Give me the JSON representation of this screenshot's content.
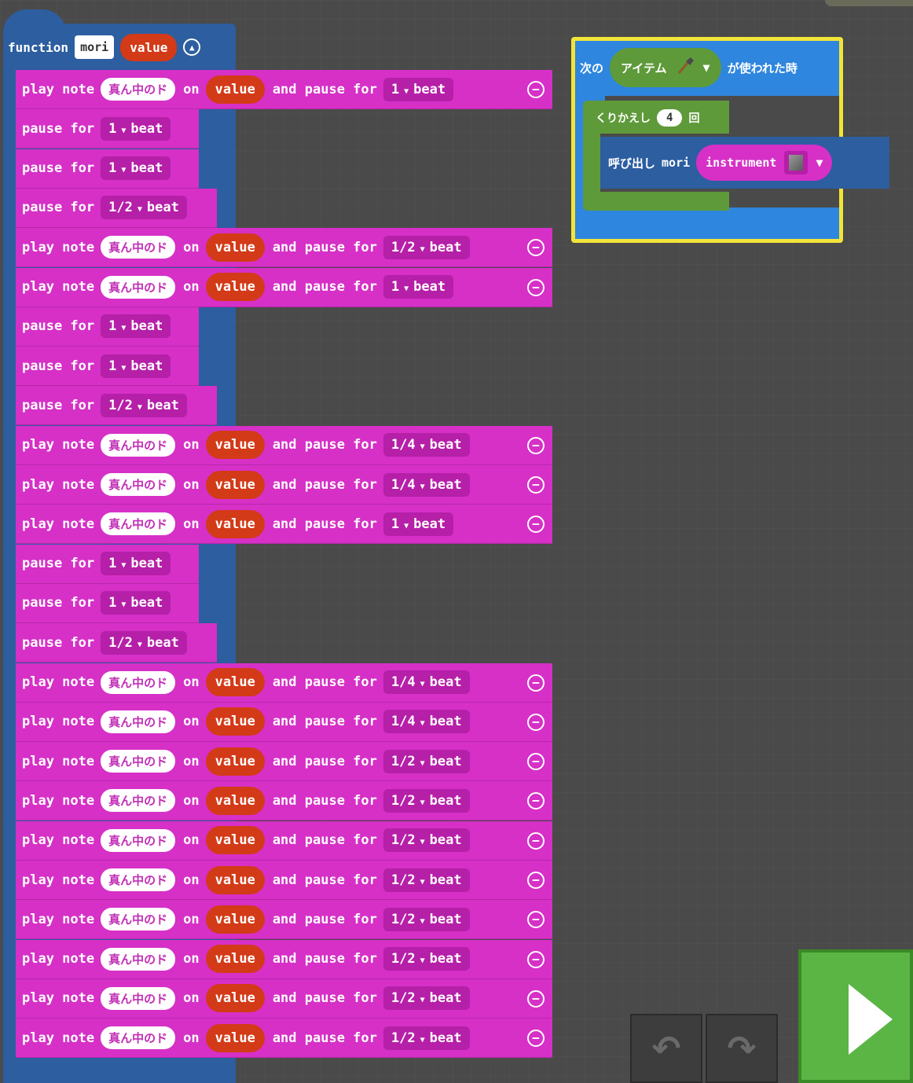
{
  "function_block": {
    "keyword": "function",
    "name": "mori",
    "param": "value"
  },
  "rows": [
    {
      "type": "play",
      "note": "真ん中のド",
      "param": "value",
      "duration": "1"
    },
    {
      "type": "pause",
      "duration": "1"
    },
    {
      "type": "pause",
      "duration": "1"
    },
    {
      "type": "pause",
      "duration": "1/2"
    },
    {
      "type": "play",
      "note": "真ん中のド",
      "param": "value",
      "duration": "1/2"
    },
    {
      "type": "play",
      "note": "真ん中のド",
      "param": "value",
      "duration": "1"
    },
    {
      "type": "pause",
      "duration": "1"
    },
    {
      "type": "pause",
      "duration": "1"
    },
    {
      "type": "pause",
      "duration": "1/2"
    },
    {
      "type": "play",
      "note": "真ん中のド",
      "param": "value",
      "duration": "1/4"
    },
    {
      "type": "play",
      "note": "真ん中のド",
      "param": "value",
      "duration": "1/4"
    },
    {
      "type": "play",
      "note": "真ん中のド",
      "param": "value",
      "duration": "1"
    },
    {
      "type": "pause",
      "duration": "1"
    },
    {
      "type": "pause",
      "duration": "1"
    },
    {
      "type": "pause",
      "duration": "1/2"
    },
    {
      "type": "play",
      "note": "真ん中のド",
      "param": "value",
      "duration": "1/4"
    },
    {
      "type": "play",
      "note": "真ん中のド",
      "param": "value",
      "duration": "1/4"
    },
    {
      "type": "play",
      "note": "真ん中のド",
      "param": "value",
      "duration": "1/2"
    },
    {
      "type": "play",
      "note": "真ん中のド",
      "param": "value",
      "duration": "1/2"
    },
    {
      "type": "play",
      "note": "真ん中のド",
      "param": "value",
      "duration": "1/2"
    },
    {
      "type": "play",
      "note": "真ん中のド",
      "param": "value",
      "duration": "1/2"
    },
    {
      "type": "play",
      "note": "真ん中のド",
      "param": "value",
      "duration": "1/2"
    },
    {
      "type": "play",
      "note": "真ん中のド",
      "param": "value",
      "duration": "1/2"
    },
    {
      "type": "play",
      "note": "真ん中のド",
      "param": "value",
      "duration": "1/2"
    },
    {
      "type": "play",
      "note": "真ん中のド",
      "param": "value",
      "duration": "1/2"
    }
  ],
  "labels": {
    "play_note": "play note",
    "on": "on",
    "and_pause_for": "and pause for",
    "pause_for": "pause for",
    "beat": "beat"
  },
  "event_block": {
    "prefix": "次の",
    "item_label": "アイテム",
    "item_icon": "shovel-icon",
    "suffix": "が使われた時"
  },
  "loop_block": {
    "label": "くりかえし",
    "count": "4",
    "suffix": "回"
  },
  "call_block": {
    "label": "呼び出し",
    "name": "mori",
    "arg_label": "instrument",
    "arg_icon": "stone-block-icon"
  },
  "controls": {
    "undo_icon": "undo-icon",
    "redo_icon": "redo-icon",
    "run_icon": "play-icon"
  },
  "colors": {
    "music_block": "#d630c7",
    "function_block": "#2c5ea0",
    "event_block": "#2e86de",
    "loop_block": "#5f9a3a",
    "variable_pill": "#d33a17",
    "selection_outline": "#f2e43a",
    "run_button": "#5ab544"
  }
}
